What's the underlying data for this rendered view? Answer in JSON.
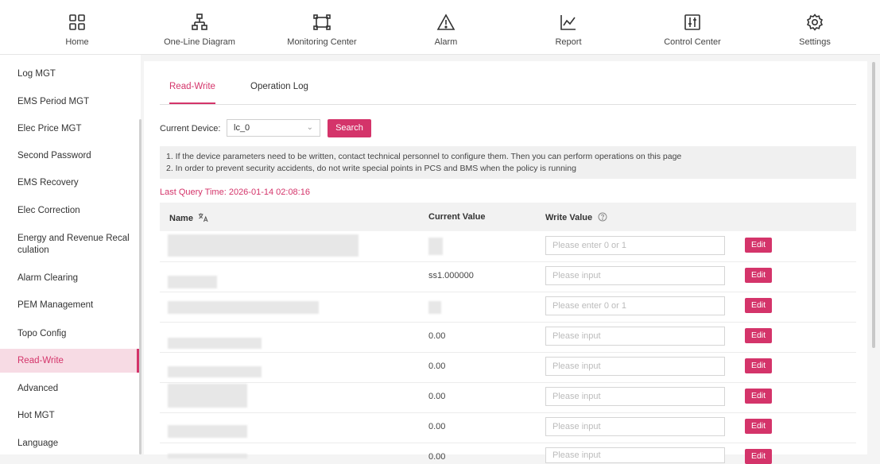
{
  "nav": [
    {
      "label": "Home",
      "icon": "home-grid-icon"
    },
    {
      "label": "One-Line Diagram",
      "icon": "one-line-diagram-icon"
    },
    {
      "label": "Monitoring Center",
      "icon": "monitoring-frame-icon"
    },
    {
      "label": "Alarm",
      "icon": "alarm-warning-icon"
    },
    {
      "label": "Report",
      "icon": "report-chart-icon"
    },
    {
      "label": "Control Center",
      "icon": "control-sliders-icon"
    },
    {
      "label": "Settings",
      "icon": "settings-gear-icon"
    }
  ],
  "sidebar": {
    "items": [
      {
        "label": "Log MGT"
      },
      {
        "label": "EMS Period MGT"
      },
      {
        "label": "Elec Price MGT"
      },
      {
        "label": "Second Password"
      },
      {
        "label": "EMS Recovery"
      },
      {
        "label": "Elec Correction"
      },
      {
        "label": "Energy and Revenue Recal",
        "label2": "culation"
      },
      {
        "label": "Alarm Clearing"
      },
      {
        "label": "PEM Management"
      },
      {
        "label": "Topo Config"
      },
      {
        "label": "Read-Write",
        "active": true
      },
      {
        "label": "Advanced"
      },
      {
        "label": "Hot MGT"
      },
      {
        "label": "Language"
      }
    ]
  },
  "tabs": [
    {
      "label": "Read-Write",
      "active": true
    },
    {
      "label": "Operation Log"
    }
  ],
  "device": {
    "label": "Current Device:",
    "value": "lc_0",
    "chevron": "⌄",
    "search_label": "Search"
  },
  "notice": {
    "line1": "1. If the device parameters need to be written, contact technical personnel to configure them. Then you can perform operations on this page",
    "line2": "2. In order to prevent security accidents, do not write special points in PCS and BMS when the policy is running"
  },
  "last_query": {
    "label": "Last Query Time:",
    "time": "2026-01-14 02:08:16"
  },
  "table": {
    "headers": {
      "name": "Name",
      "current": "Current Value",
      "write": "Write Value"
    },
    "edit_label": "Edit",
    "rows": [
      {
        "current": "",
        "placeholder": "Please enter 0 or 1"
      },
      {
        "current": "ss1.000000",
        "placeholder": "Please input"
      },
      {
        "current": "",
        "placeholder": "Please enter 0 or 1"
      },
      {
        "current": "0.00",
        "placeholder": "Please input"
      },
      {
        "current": "0.00",
        "placeholder": "Please input"
      },
      {
        "current": "0.00",
        "placeholder": "Please input"
      },
      {
        "current": "0.00",
        "placeholder": "Please input"
      },
      {
        "current": "0.00",
        "placeholder": "Please input"
      }
    ]
  },
  "colors": {
    "accent": "#d4346a",
    "active_bg": "#f7dbe4"
  }
}
